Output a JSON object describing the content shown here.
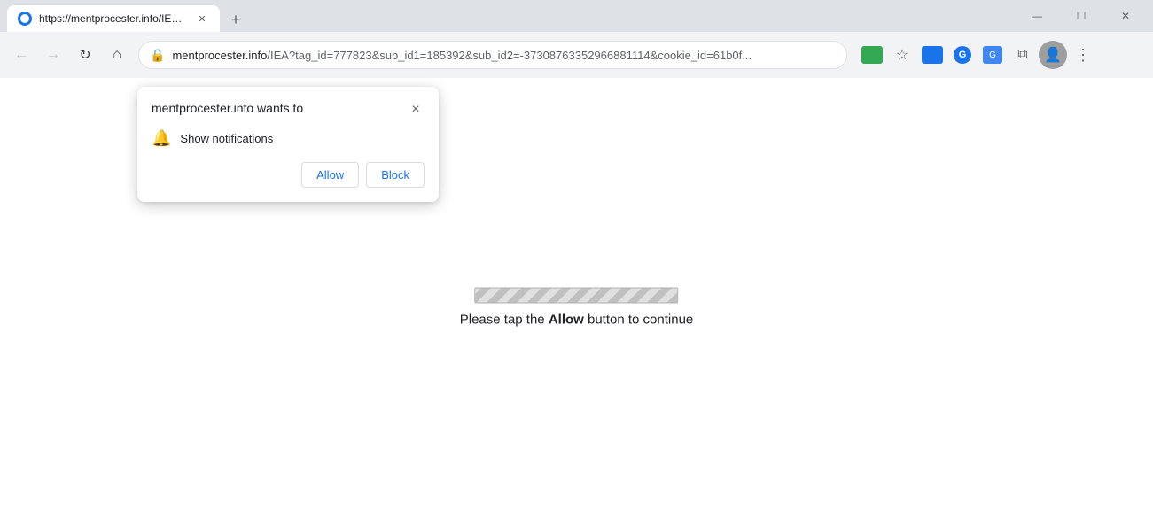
{
  "browser": {
    "tab": {
      "favicon_label": "mentprocester tab",
      "title": "https://mentprocester.info/IEA?t..."
    },
    "new_tab_label": "+",
    "window_controls": {
      "minimize": "—",
      "maximize": "☐",
      "close": "✕"
    },
    "nav": {
      "back": "←",
      "forward": "→",
      "refresh": "↻",
      "home": "⌂"
    },
    "url": {
      "host": "mentprocester.info",
      "path": "/IEA?tag_id=777823&sub_id1=185392&sub_id2=-37308763352966881114&cookie_id=61b0f..."
    },
    "toolbar": {
      "extensions_icon": "⧉",
      "star_icon": "☆",
      "profile_label": "👤",
      "menu_icon": "⋮"
    }
  },
  "notification_popup": {
    "title": "mentprocester.info wants to",
    "close_label": "×",
    "permission_item": {
      "icon_label": "🔔",
      "text": "Show notifications"
    },
    "allow_btn": "Allow",
    "block_btn": "Block"
  },
  "page": {
    "instruction_prefix": "Please tap the ",
    "instruction_bold": "Allow",
    "instruction_suffix": " button to continue"
  }
}
